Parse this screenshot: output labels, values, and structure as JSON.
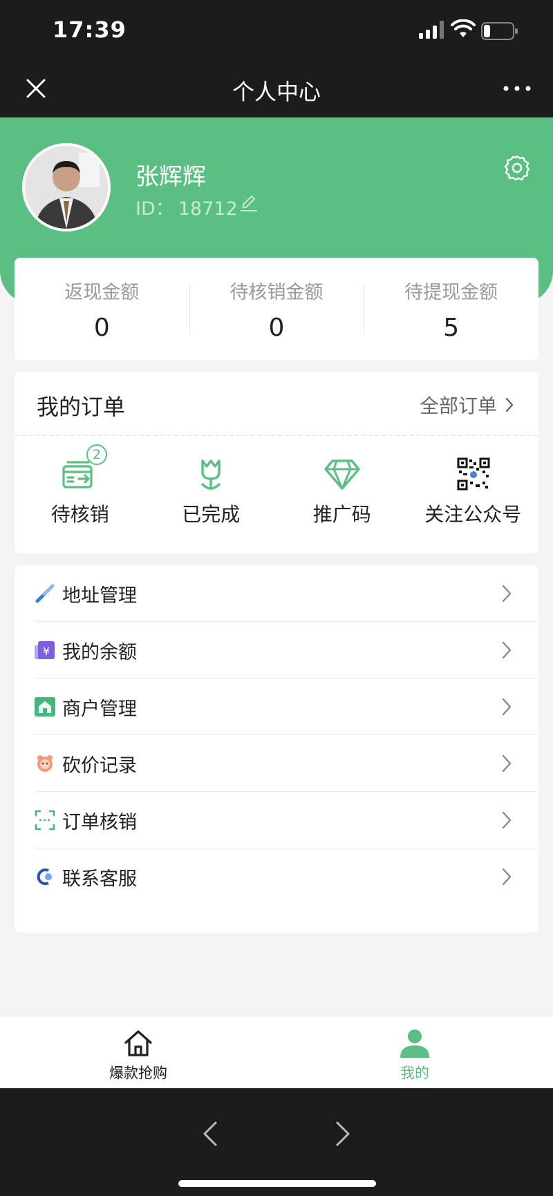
{
  "status_bar": {
    "time": "17:39"
  },
  "nav": {
    "title": "个人中心",
    "close_icon": "close-icon",
    "more_icon": "more-icon"
  },
  "profile": {
    "name": "张辉辉",
    "id_label": "ID：",
    "id_value": "18712",
    "settings_icon": "gear-icon"
  },
  "balances": [
    {
      "label": "返现金额",
      "value": "0"
    },
    {
      "label": "待核销金额",
      "value": "0"
    },
    {
      "label": "待提现金额",
      "value": "5"
    }
  ],
  "orders": {
    "title": "我的订单",
    "all_label": "全部订单",
    "items": [
      {
        "label": "待核销",
        "icon": "pending-verify-icon",
        "badge": "2"
      },
      {
        "label": "已完成",
        "icon": "tulip-icon"
      },
      {
        "label": "推广码",
        "icon": "diamond-icon"
      },
      {
        "label": "关注公众号",
        "icon": "qrcode-icon"
      }
    ]
  },
  "menu": [
    {
      "label": "地址管理",
      "icon": "address-icon"
    },
    {
      "label": "我的余额",
      "icon": "balance-icon"
    },
    {
      "label": "商户管理",
      "icon": "merchant-icon"
    },
    {
      "label": "砍价记录",
      "icon": "bargain-icon"
    },
    {
      "label": "订单核销",
      "icon": "scan-icon"
    },
    {
      "label": "联系客服",
      "icon": "service-icon"
    }
  ],
  "tabs": [
    {
      "label": "爆款抢购",
      "icon": "home-icon",
      "active": false
    },
    {
      "label": "我的",
      "icon": "user-icon",
      "active": true
    }
  ],
  "colors": {
    "primary": "#5bbf83",
    "dark": "#1c1c1c",
    "background": "#f4f4f4"
  }
}
